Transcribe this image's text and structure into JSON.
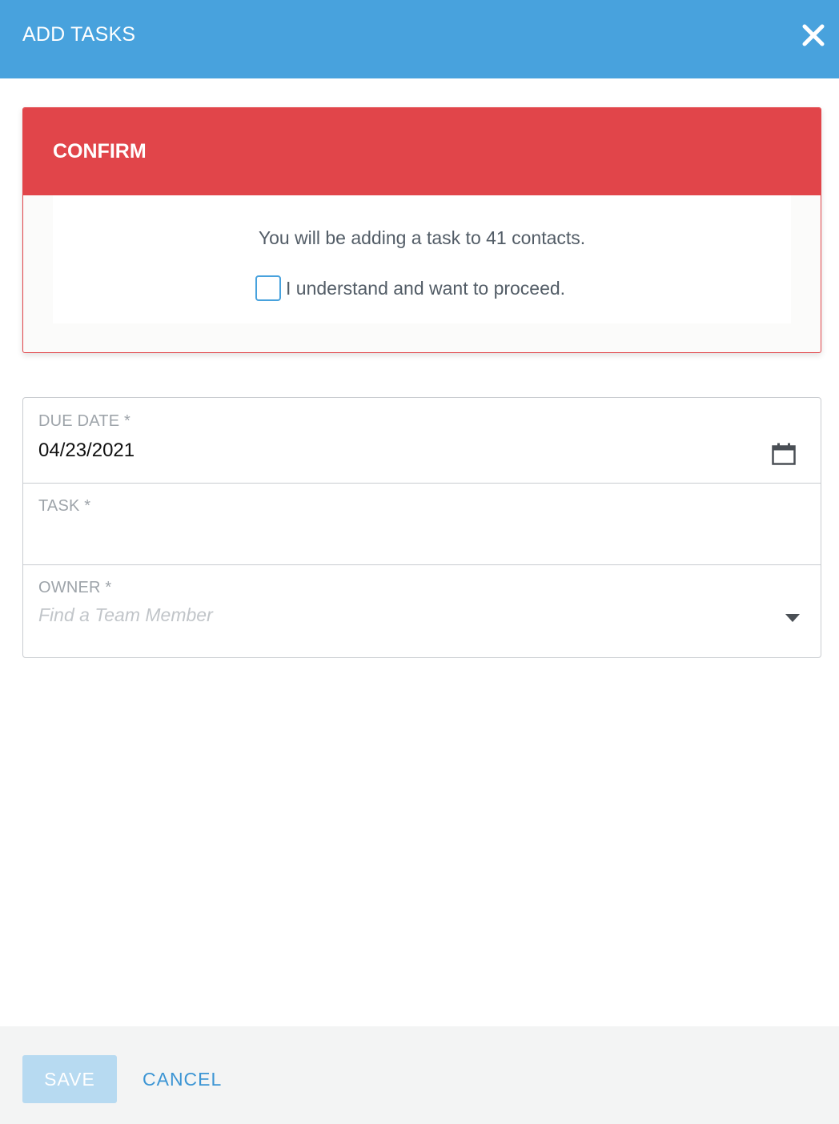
{
  "header": {
    "title": "ADD TASKS",
    "close_icon": "close-icon"
  },
  "confirm": {
    "title": "CONFIRM",
    "message": "You will be adding a task to 41 contacts.",
    "checkbox_label": "I understand and want to proceed.",
    "checked": false
  },
  "form": {
    "due_date": {
      "label": "DUE DATE *",
      "value": "04/23/2021",
      "icon": "calendar-icon"
    },
    "task": {
      "label": "TASK *",
      "value": ""
    },
    "owner": {
      "label": "OWNER *",
      "placeholder": "Find a Team Member",
      "icon": "caret-down-icon"
    }
  },
  "footer": {
    "save_label": "SAVE",
    "cancel_label": "CANCEL"
  },
  "colors": {
    "header": "#48a2dd",
    "confirm": "#e1454a",
    "save_disabled": "#b7daf1",
    "link": "#3c95d4"
  }
}
